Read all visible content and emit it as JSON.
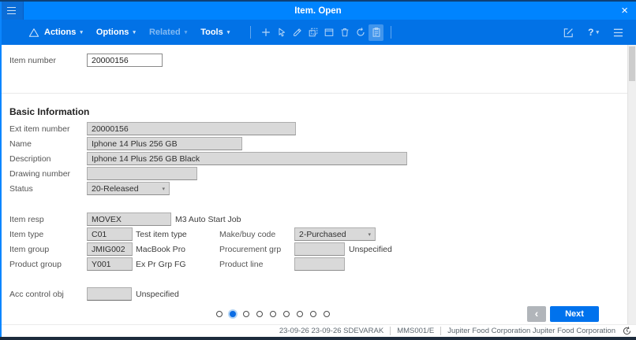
{
  "window": {
    "title": "Item. Open",
    "close_glyph": "×"
  },
  "toolbar": {
    "menus": [
      {
        "label": "Actions",
        "caret": "▾",
        "disabled": false
      },
      {
        "label": "Options",
        "caret": "▾",
        "disabled": false
      },
      {
        "label": "Related",
        "caret": "▾",
        "disabled": true
      },
      {
        "label": "Tools",
        "caret": "▾",
        "disabled": false
      }
    ],
    "icons": [
      "plus-icon",
      "select-cursor-icon",
      "edit-pencil-icon",
      "copy-icon",
      "panel-icon",
      "trash-icon",
      "refresh-icon",
      "clipboard-icon"
    ],
    "right_icons": [
      "compose-icon",
      "help-icon",
      "menu-lines-icon"
    ],
    "help_label": "?",
    "help_caret": "▾"
  },
  "panel_top": {
    "item_number": {
      "label": "Item number",
      "value": "20000156"
    }
  },
  "basic": {
    "title": "Basic Information",
    "fields": {
      "ext_item_number": {
        "label": "Ext item number",
        "value": "20000156"
      },
      "name": {
        "label": "Name",
        "value": "Iphone 14 Plus 256 GB"
      },
      "description": {
        "label": "Description",
        "value": "Iphone 14 Plus 256 GB Black"
      },
      "drawing_number": {
        "label": "Drawing number",
        "value": ""
      },
      "status": {
        "label": "Status",
        "value": "20-Released",
        "arrow": "▾"
      },
      "item_resp": {
        "label": "Item resp",
        "value": "MOVEX",
        "description": "M3 Auto Start Job"
      },
      "item_type": {
        "label": "Item type",
        "value": "C01",
        "description": "Test item type"
      },
      "item_group": {
        "label": "Item group",
        "value": "JMIG002",
        "description": "MacBook Pro"
      },
      "product_group": {
        "label": "Product group",
        "value": "Y001",
        "description": "Ex Pr Grp FG"
      },
      "make_buy_code": {
        "label": "Make/buy code",
        "value": "2-Purchased",
        "arrow": "▾"
      },
      "procurement_grp": {
        "label": "Procurement grp",
        "value": "",
        "description": "Unspecified"
      },
      "product_line": {
        "label": "Product line",
        "value": ""
      },
      "acc_control_obj": {
        "label": "Acc control obj",
        "value": "",
        "description": "Unspecified"
      }
    }
  },
  "pagination": {
    "total": 9,
    "active_index": 1
  },
  "nav": {
    "back_glyph": "‹",
    "next_label": "Next"
  },
  "status_bar": {
    "timestamp_user": "23-09-26 23-09-26 SDEVARAK",
    "program": "MMS001/E",
    "company": "Jupiter Food Corporation Jupiter Food Corporation"
  },
  "colors": {
    "titlebar": "#0084ff",
    "toolbar": "#0272e6",
    "accent": "#0072ed",
    "disabled_field": "#d9d9d9",
    "bottom_edge": "#1d2b3c"
  }
}
